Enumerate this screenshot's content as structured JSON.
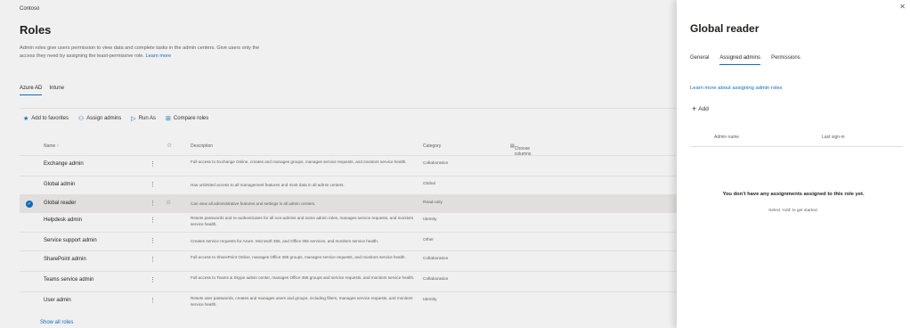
{
  "org": "Contoso",
  "page": {
    "title": "Roles",
    "description": "Admin roles give users permission to view data and complete tasks in the admin centers. Give users only the access they need by assigning the least-permissive role.",
    "learn_more": "Learn more"
  },
  "tabs": [
    "Azure AD",
    "Intune"
  ],
  "commands": {
    "add_favorites": "Add to favorites",
    "assign_admins": "Assign admins",
    "run_as": "Run As",
    "compare_roles": "Compare roles"
  },
  "table": {
    "col_name": "Name ↑",
    "col_star": "☆",
    "col_description": "Description",
    "col_category": "Category",
    "choose_columns": "Choose columns",
    "rows": [
      {
        "name": "Exchange admin",
        "description": "Full access to Exchange Online, creates and manages groups, manages service requests, and monitors service health.",
        "category": "Collaboration",
        "selected": false
      },
      {
        "name": "Global admin",
        "description": "Has unlimited access to all management features and most data in all admin centers.",
        "category": "Global",
        "selected": false
      },
      {
        "name": "Global reader",
        "description": "Can view all administrative features and settings in all admin centers.",
        "category": "Read-only",
        "selected": true
      },
      {
        "name": "Helpdesk admin",
        "description": "Resets passwords and re-authenticates for all non-admins and some admin roles, manages service requests, and monitors service health.",
        "category": "Identity",
        "selected": false
      },
      {
        "name": "Service support admin",
        "description": "Creates service requests for Azure, Microsoft 365, and Office 365 services, and monitors service health.",
        "category": "Other",
        "selected": false
      },
      {
        "name": "SharePoint admin",
        "description": "Full access to SharePoint Online, manages Office 365 groups, manages service requests, and monitors service health.",
        "category": "Collaboration",
        "selected": false
      },
      {
        "name": "Teams service admin",
        "description": "Full access to Teams & Skype admin center, manages Office 365 groups and service requests, and monitors service health.",
        "category": "Collaboration",
        "selected": false
      },
      {
        "name": "User admin",
        "description": "Resets user passwords, creates and manages users and groups, including filters, manages service requests, and monitors service health.",
        "category": "Identity",
        "selected": false
      }
    ],
    "show_all": "Show all roles"
  },
  "panel": {
    "title": "Global reader",
    "tabs": [
      "General",
      "Assigned admins",
      "Permissions"
    ],
    "active_tab": "Assigned admins",
    "learn_link": "Learn more about assigning admin roles",
    "add_label": "Add",
    "col_admin_name": "Admin name",
    "col_last_signin": "Last sign-in",
    "empty_title": "You don't have any assignments assigned to this role yet.",
    "empty_sub": "Select 'Add' to get started."
  },
  "colors": {
    "accent": "#0f6cbd",
    "selected_row": "#e1dfdd"
  }
}
